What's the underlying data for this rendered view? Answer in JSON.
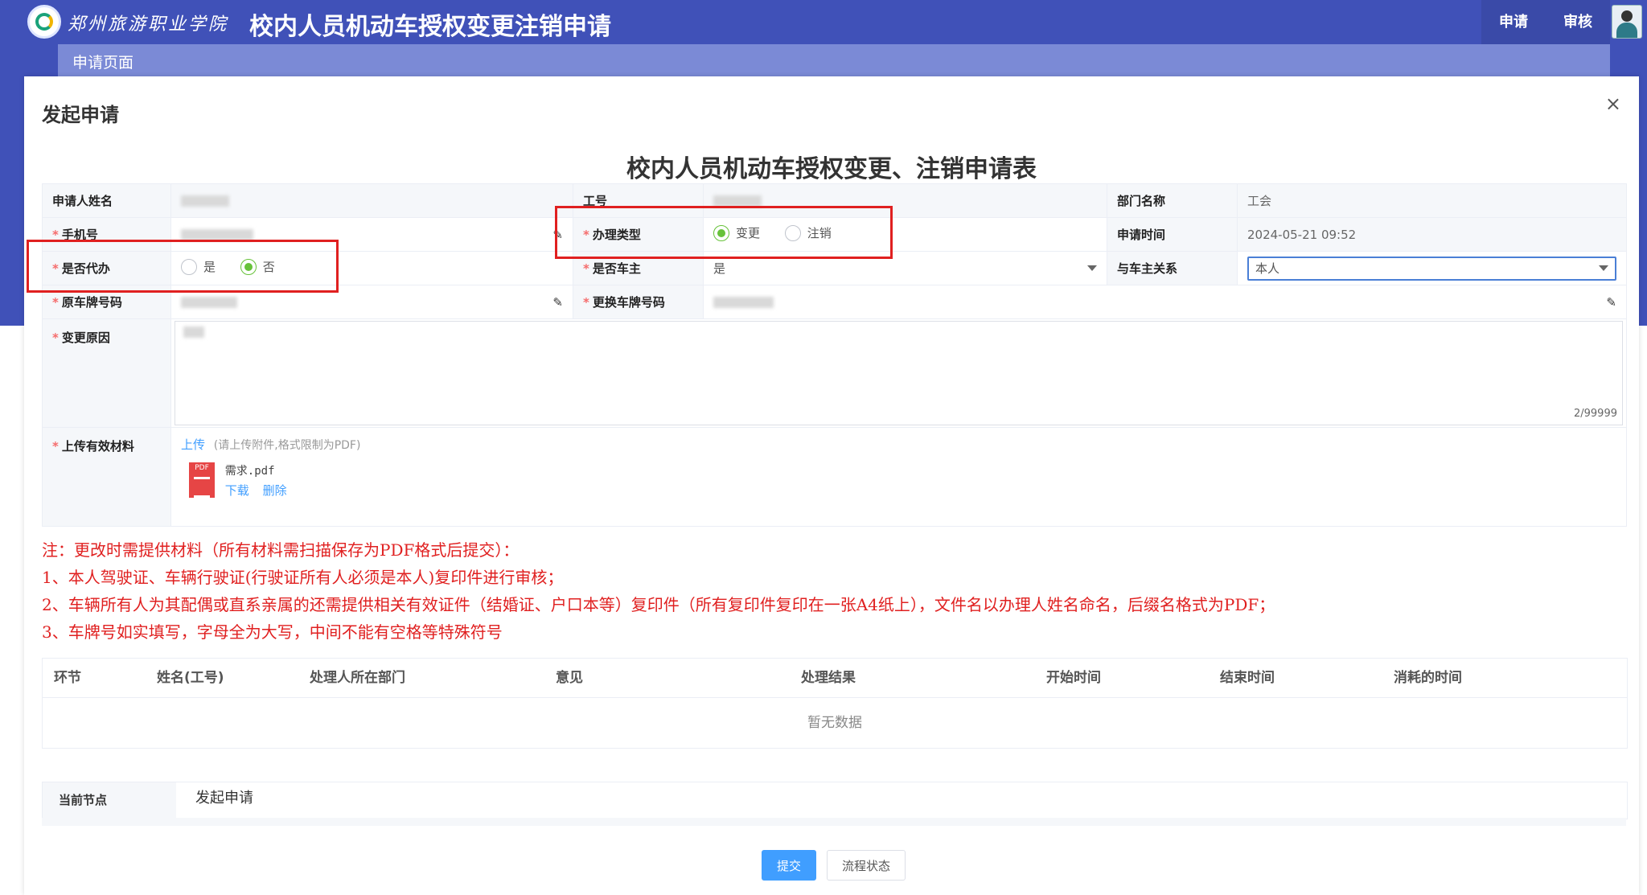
{
  "header": {
    "school_name": "郑州旅游职业学院",
    "app_title": "校内人员机动车授权变更注销申请",
    "nav": [
      "申请",
      "审核"
    ]
  },
  "subbar": {
    "label": "申请页面"
  },
  "dialog": {
    "title": "发起申请",
    "close": "×"
  },
  "form": {
    "title": "校内人员机动车授权变更、注销申请表",
    "labels": {
      "applicant": "申请人姓名",
      "work_id": "工号",
      "dept": "部门名称",
      "phone": "手机号",
      "handle_type": "办理类型",
      "apply_time": "申请时间",
      "is_proxy": "是否代办",
      "is_owner": "是否车主",
      "owner_relation": "与车主关系",
      "old_plate": "原车牌号码",
      "new_plate": "更换车牌号码",
      "reason": "变更原因",
      "materials": "上传有效材料"
    },
    "values": {
      "dept": "工会",
      "apply_time": "2024-05-21 09:52",
      "is_owner": "是",
      "owner_relation": "本人",
      "reason_counter": "2/99999"
    },
    "handle_type_options": [
      "变更",
      "注销"
    ],
    "handle_type_selected": "变更",
    "proxy_options": [
      "是",
      "否"
    ],
    "proxy_selected": "否",
    "upload": {
      "link": "上传",
      "hint": "(请上传附件,格式限制为PDF)",
      "file_name": "需求.pdf",
      "icon_text": "PDF",
      "download": "下载",
      "delete": "删除"
    }
  },
  "notes": [
    "注：更改时需提供材料（所有材料需扫描保存为PDF格式后提交）：",
    "1、本人驾驶证、车辆行驶证(行驶证所有人必须是本人)复印件进行审核；",
    "2、车辆所有人为其配偶或直系亲属的还需提供相关有效证件（结婚证、户口本等）复印件（所有复印件复印在一张A4纸上），文件名以办理人姓名命名，后缀名格式为PDF；",
    "3、车牌号如实填写，字母全为大写，中间不能有空格等特殊符号"
  ],
  "process_table": {
    "columns": [
      "环节",
      "姓名(工号)",
      "处理人所在部门",
      "意见",
      "处理结果",
      "开始时间",
      "结束时间",
      "消耗的时间"
    ],
    "empty_text": "暂无数据"
  },
  "current_node": {
    "label": "当前节点",
    "value": "发起申请"
  },
  "buttons": {
    "submit": "提交",
    "status": "流程状态"
  },
  "colors": {
    "header_bg": "#4051b8",
    "subbar_bg": "#7b8ad6",
    "primary": "#409eff",
    "note_red": "#e02020",
    "radio_green": "#67c23a"
  }
}
